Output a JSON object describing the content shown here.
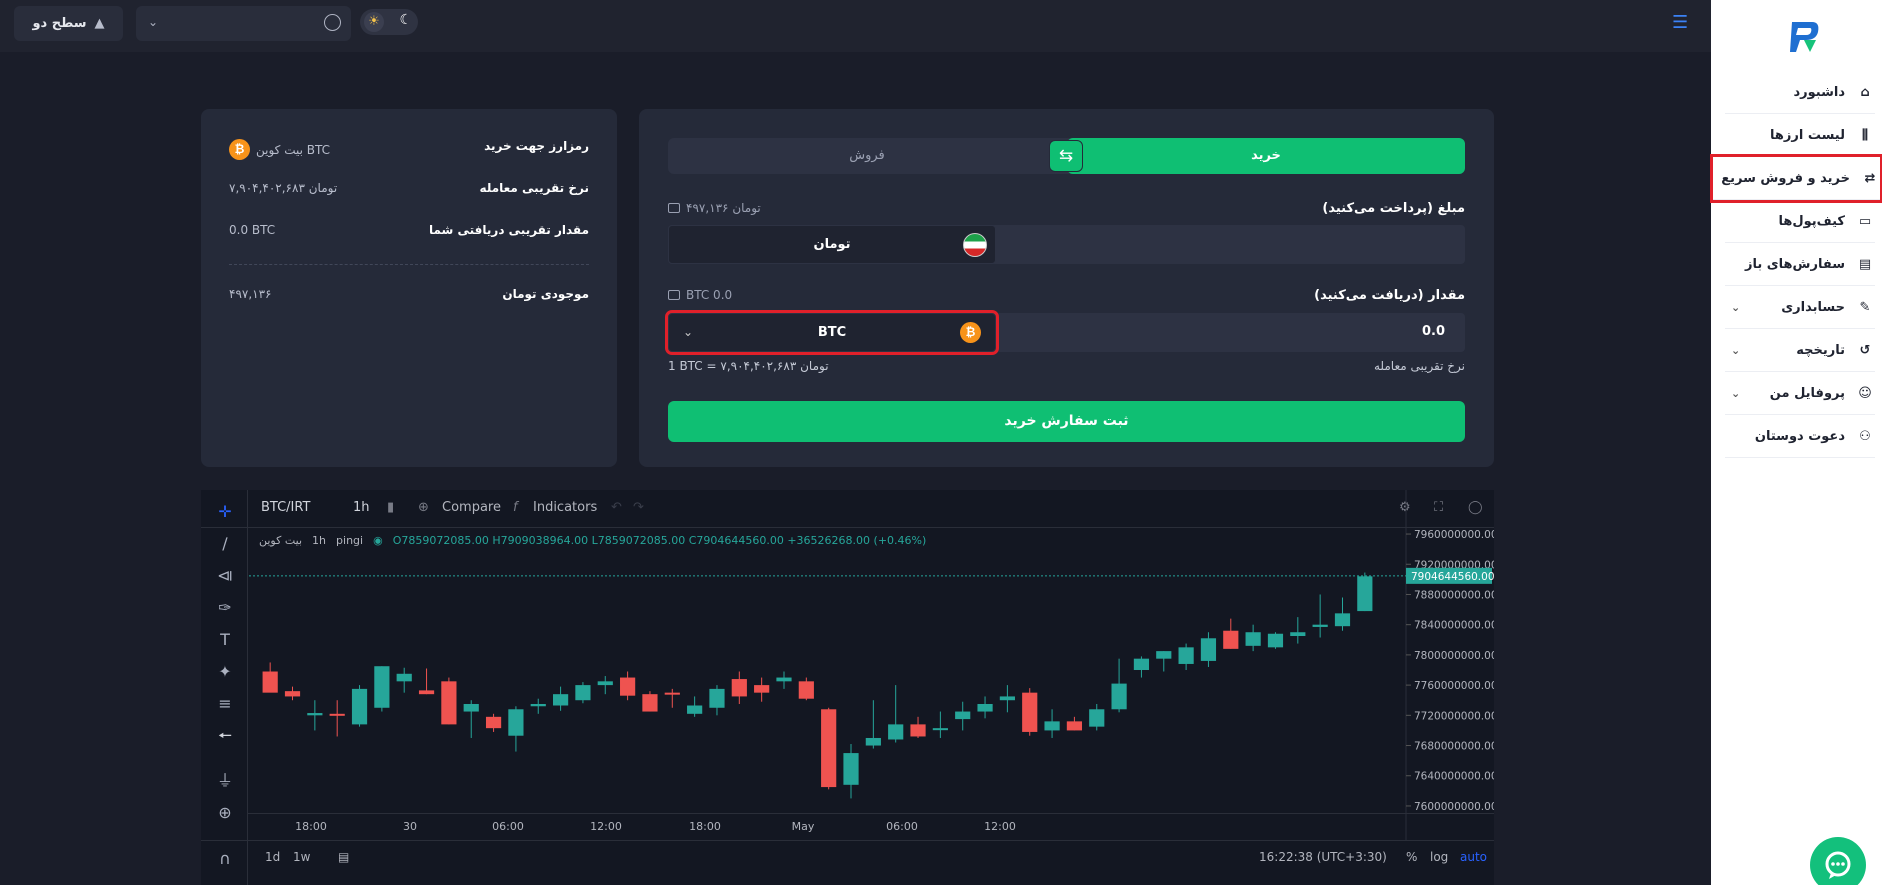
{
  "topbar": {
    "level_label": "سطح دو",
    "select_value": ""
  },
  "sidebar": {
    "items": [
      {
        "label": "داشبورد",
        "icon": "home-icon"
      },
      {
        "label": "لیست ارزها",
        "icon": "candles-icon"
      },
      {
        "label": "خرید و فروش سریع",
        "icon": "quick-trade-icon",
        "active": true
      },
      {
        "label": "کیف‌پول‌ها",
        "icon": "wallet-icon"
      },
      {
        "label": "سفارش‌های باز",
        "icon": "orders-icon"
      },
      {
        "label": "حسابداری",
        "icon": "ledger-icon",
        "expandable": true
      },
      {
        "label": "تاریخچه",
        "icon": "history-icon",
        "expandable": true
      },
      {
        "label": "پروفایل من",
        "icon": "profile-icon",
        "expandable": true
      },
      {
        "label": "دعوت دوستان",
        "icon": "invite-icon"
      }
    ]
  },
  "info": {
    "crypto_label": "رمزارز جهت خرید",
    "crypto_value": "بیت کوین  BTC",
    "rate_label": "نرخ تقریبی معامله",
    "rate_value": "تومان ۷,۹۰۴,۴۰۲,۶۸۳",
    "receive_label": "مقدار تقریبی دریافتی شما",
    "receive_value": "0.0 BTC",
    "balance_label": "موجودی تومان",
    "balance_value": "۴۹۷,۱۳۶"
  },
  "trade": {
    "tab_buy": "خرید",
    "tab_sell": "فروش",
    "pay_label": "مبلغ (پرداخت می‌کنید)",
    "pay_balance": "۴۹۷,۱۳۶  تومان",
    "pay_currency": "تومان",
    "pay_value": "",
    "receive_label": "مقدار (دریافت می‌کنید)",
    "receive_balance": "BTC  0.0",
    "receive_currency": "BTC",
    "receive_value": "0.0",
    "rate_label": "نرخ تقریبی معامله",
    "rate_value": "1 BTC = ۷,۹۰۴,۴۰۲,۶۸۳ تومان",
    "submit_label": "ثبت سفارش خرید"
  },
  "chart_toolbar": {
    "symbol": "BTC/IRT",
    "interval": "1h",
    "compare": "Compare",
    "indicators": "Indicators"
  },
  "chart_legend": {
    "name": "بیت کوین",
    "interval": "1h",
    "source": "pingi",
    "ohlc": "O7859072085.00  H7909038964.00  L7859072085.00  C7904644560.00  +36526268.00 (+0.46%)"
  },
  "chart_bottom": {
    "range_1d": "1d",
    "range_1w": "1w",
    "clock": "16:22:38 (UTC+3:30)",
    "percent": "%",
    "log": "log",
    "auto": "auto"
  },
  "chart_data": {
    "type": "candlestick",
    "symbol": "BTC/IRT",
    "last_price": "7904644560.00",
    "y_ticks": [
      "7960000000.00",
      "7920000000.00",
      "7880000000.00",
      "7840000000.00",
      "7800000000.00",
      "7760000000.00",
      "7720000000.00",
      "7680000000.00",
      "7640000000.00",
      "7600000000.00"
    ],
    "x_ticks": [
      "18:00",
      "30",
      "06:00",
      "12:00",
      "18:00",
      "May",
      "06:00",
      "12:00"
    ],
    "ylim": [
      7592000000,
      7968000000
    ],
    "colors": {
      "up": "#26a69a",
      "down": "#ef5350"
    },
    "candles": [
      [
        7778000000,
        7790000000,
        7752000000,
        7750000000
      ],
      [
        7752000000,
        7758000000,
        7740000000,
        7745000000
      ],
      [
        7720000000,
        7740000000,
        7700000000,
        7723000000
      ],
      [
        7722000000,
        7740000000,
        7692000000,
        7720000000
      ],
      [
        7708000000,
        7760000000,
        7705000000,
        7755000000
      ],
      [
        7730000000,
        7785000000,
        7725000000,
        7785000000
      ],
      [
        7765000000,
        7783000000,
        7750000000,
        7775000000
      ],
      [
        7753000000,
        7782000000,
        7748000000,
        7748000000
      ],
      [
        7765000000,
        7770000000,
        7708000000,
        7708000000
      ],
      [
        7725000000,
        7740000000,
        7690000000,
        7735000000
      ],
      [
        7718000000,
        7722000000,
        7698000000,
        7703000000
      ],
      [
        7693000000,
        7732000000,
        7672000000,
        7728000000
      ],
      [
        7732000000,
        7742000000,
        7722000000,
        7735000000
      ],
      [
        7733000000,
        7758000000,
        7726000000,
        7748000000
      ],
      [
        7740000000,
        7764000000,
        7736000000,
        7760000000
      ],
      [
        7760000000,
        7772000000,
        7748000000,
        7765000000
      ],
      [
        7770000000,
        7778000000,
        7740000000,
        7746000000
      ],
      [
        7748000000,
        7752000000,
        7725000000,
        7725000000
      ],
      [
        7750000000,
        7755000000,
        7730000000,
        7748000000
      ],
      [
        7722000000,
        7745000000,
        7718000000,
        7733000000
      ],
      [
        7730000000,
        7760000000,
        7720000000,
        7755000000
      ],
      [
        7768000000,
        7778000000,
        7735000000,
        7745000000
      ],
      [
        7760000000,
        7770000000,
        7738000000,
        7750000000
      ],
      [
        7765000000,
        7778000000,
        7755000000,
        7770000000
      ],
      [
        7765000000,
        7770000000,
        7740000000,
        7742000000
      ],
      [
        7728000000,
        7730000000,
        7622000000,
        7625000000
      ],
      [
        7628000000,
        7682000000,
        7610000000,
        7670000000
      ],
      [
        7680000000,
        7740000000,
        7676000000,
        7690000000
      ],
      [
        7688000000,
        7760000000,
        7684000000,
        7708000000
      ],
      [
        7708000000,
        7718000000,
        7690000000,
        7692000000
      ],
      [
        7702000000,
        7725000000,
        7690000000,
        7703000000
      ],
      [
        7715000000,
        7738000000,
        7700000000,
        7725000000
      ],
      [
        7725000000,
        7745000000,
        7716000000,
        7735000000
      ],
      [
        7740000000,
        7760000000,
        7724000000,
        7745000000
      ],
      [
        7750000000,
        7756000000,
        7693000000,
        7698000000
      ],
      [
        7700000000,
        7728000000,
        7690000000,
        7712000000
      ],
      [
        7712000000,
        7718000000,
        7700000000,
        7700000000
      ],
      [
        7705000000,
        7735000000,
        7700000000,
        7728000000
      ],
      [
        7728000000,
        7795000000,
        7724000000,
        7762000000
      ],
      [
        7780000000,
        7798000000,
        7770000000,
        7795000000
      ],
      [
        7795000000,
        7805000000,
        7778000000,
        7805000000
      ],
      [
        7788000000,
        7815000000,
        7780000000,
        7810000000
      ],
      [
        7792000000,
        7830000000,
        7784000000,
        7822000000
      ],
      [
        7832000000,
        7848000000,
        7808000000,
        7808000000
      ],
      [
        7812000000,
        7840000000,
        7805000000,
        7830000000
      ],
      [
        7810000000,
        7830000000,
        7808000000,
        7828000000
      ],
      [
        7825000000,
        7850000000,
        7815000000,
        7830000000
      ],
      [
        7837000000,
        7880000000,
        7823000000,
        7840000000
      ],
      [
        7838000000,
        7876000000,
        7832000000,
        7855000000
      ],
      [
        7858000000,
        7909000000,
        7858000000,
        7904000000
      ]
    ]
  }
}
